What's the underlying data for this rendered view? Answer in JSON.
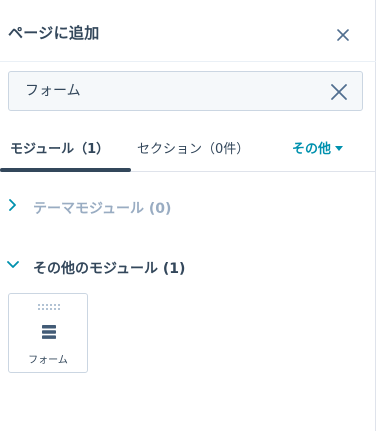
{
  "panel": {
    "title": "ページに追加"
  },
  "search": {
    "value": "フォーム",
    "placeholder": ""
  },
  "tabs": {
    "modules_label": "モジュール（1）",
    "sections_label": "セクション（0件）",
    "more_label": "その他"
  },
  "groups": {
    "theme_label": "テーマモジュール (0)",
    "other_label": "その他のモジュール (1)"
  },
  "modules": [
    {
      "label": "フォーム",
      "icon": "form-icon"
    }
  ],
  "colors": {
    "accent": "#0091ae",
    "text": "#33475b",
    "muted": "#99acc2",
    "border": "#cbd6e2"
  }
}
